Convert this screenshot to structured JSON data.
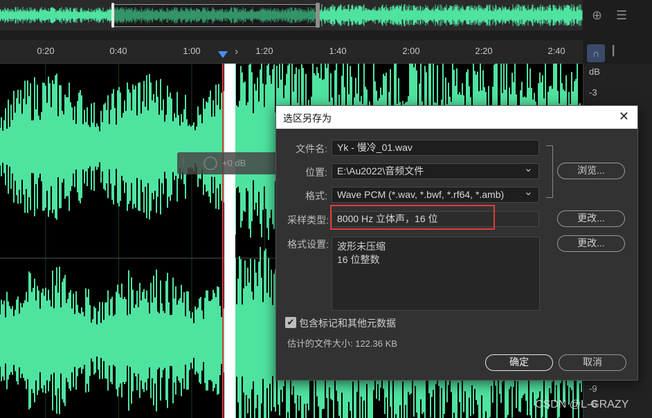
{
  "timeline": {
    "ticks": [
      "0:20",
      "0:40",
      "1:00",
      "1:20",
      "1:40",
      "2:00",
      "2:20",
      "2:40"
    ]
  },
  "db_scale": {
    "unit": "dB",
    "labels": [
      "-3",
      "-9",
      "-6"
    ]
  },
  "hud": {
    "gain": "+0 dB"
  },
  "dialog": {
    "title": "选区另存为",
    "close": "✕",
    "filename_label": "文件名:",
    "filename_value": "Yk - 慢冷_01.wav",
    "location_label": "位置:",
    "location_value": "E:\\Au2022\\音频文件",
    "format_label": "格式:",
    "format_value": "Wave PCM (*.wav, *.bwf, *.rf64, *.amb)",
    "browse_button": "浏览...",
    "sample_type_label": "采样类型:",
    "sample_type_value": "8000 Hz 立体声，16 位",
    "change_button_1": "更改...",
    "format_settings_label": "格式设置:",
    "format_settings_lines": [
      "波形未压缩",
      "16 位整数"
    ],
    "change_button_2": "更改...",
    "include_markers_label": "包含标记和其他元数据",
    "include_markers_checked": true,
    "estimated_size": "估计的文件大小: 122.36 KB",
    "ok_button": "确定",
    "cancel_button": "取消"
  },
  "watermark": "CSDN @L-GRAZY",
  "colors": {
    "waveform": "#4fe3a0",
    "highlight": "#e23a3a",
    "playhead": "#e03a3a"
  }
}
